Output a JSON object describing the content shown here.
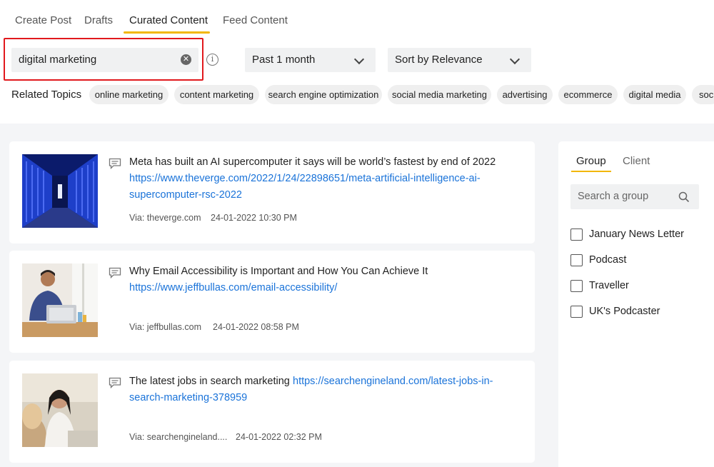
{
  "tabs": {
    "create_post": "Create Post",
    "drafts": "Drafts",
    "curated_content": "Curated Content",
    "feed_content": "Feed Content"
  },
  "search": {
    "value": "digital marketing"
  },
  "filters": {
    "time_range": "Past 1 month",
    "sort": "Sort by Relevance"
  },
  "related_topics": {
    "label": "Related Topics",
    "chips": [
      "online marketing",
      "content marketing",
      "search engine optimization",
      "social media marketing",
      "advertising",
      "ecommerce",
      "digital media",
      "soci"
    ]
  },
  "articles": [
    {
      "title": "Meta has built an AI supercomputer it says will be world’s fastest by end of 2022",
      "link_line1": "https://www.theverge.com/2022/1/24/22898651/meta-artificial-intelligence-ai-",
      "link_line2": "supercomputer-rsc-2022",
      "via": "Via: theverge.com",
      "date": "24-01-2022 10:30 PM"
    },
    {
      "title": "Why Email Accessibility is Important and How You Can Achieve It",
      "link_line1": "https://www.jeffbullas.com/email-accessibility/",
      "via": "Via: jeffbullas.com",
      "date": "24-01-2022 08:58 PM"
    },
    {
      "title": "The latest jobs in search marketing",
      "link_line1": "https://searchengineland.com/latest-jobs-in-",
      "link_line2": "search-marketing-378959",
      "via": "Via: searchengineland....",
      "date": "24-01-2022 02:32 PM"
    }
  ],
  "side_panel": {
    "tab_group": "Group",
    "tab_client": "Client",
    "search_placeholder": "Search a group",
    "groups": [
      "January News Letter",
      "Podcast",
      "Traveller",
      "UK's Podcaster"
    ]
  },
  "colors": {
    "accent": "#f2b705",
    "link": "#1a73d9",
    "highlight": "#e1191d",
    "panel_bg": "#f4f5f7"
  }
}
